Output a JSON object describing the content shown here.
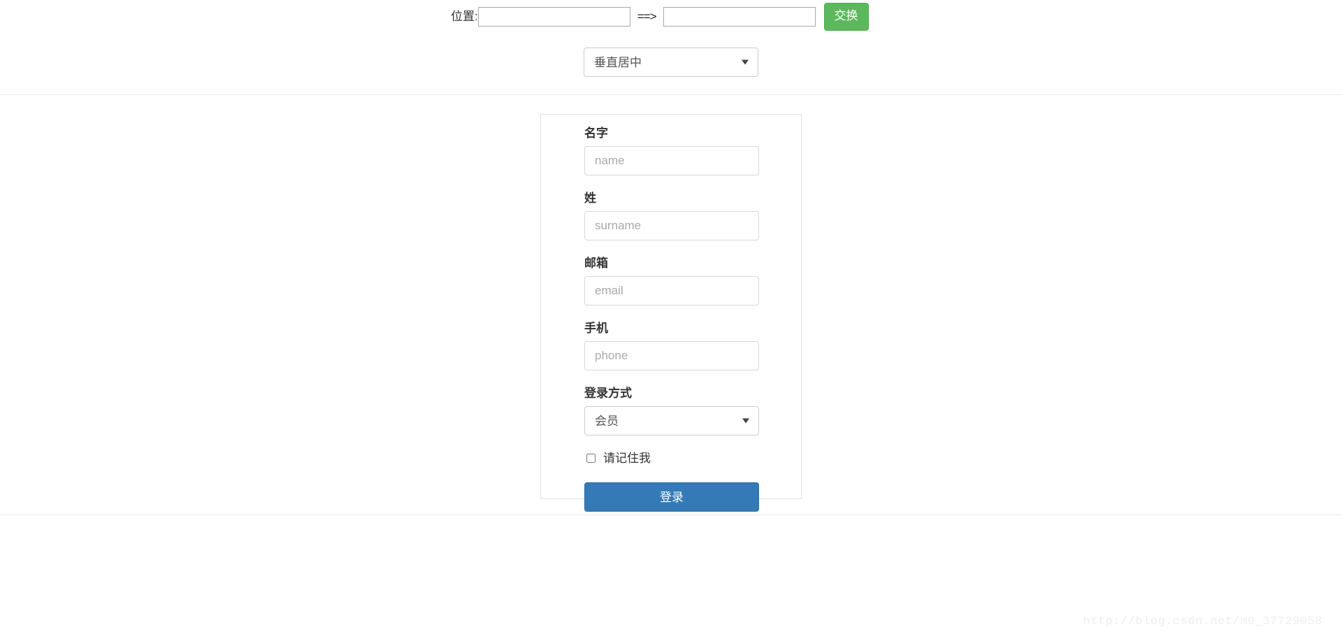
{
  "topbar": {
    "position_label": "位置:",
    "input_from_value": "",
    "input_from_placeholder": "",
    "arrow_text": "==>",
    "input_to_value": "",
    "input_to_placeholder": "",
    "swap_button_label": "交换",
    "swap_button_color": "#5cb85c"
  },
  "align_control": {
    "selected_option": "垂直居中",
    "options": [
      "垂直居中"
    ],
    "arrow_icon": "chevron-down-icon"
  },
  "form": {
    "fields": [
      {
        "label": "名字",
        "placeholder": "name",
        "value": "",
        "name": "first-name"
      },
      {
        "label": "姓",
        "placeholder": "surname",
        "value": "",
        "name": "surname"
      },
      {
        "label": "邮箱",
        "placeholder": "email",
        "value": "",
        "name": "email"
      },
      {
        "label": "手机",
        "placeholder": "phone",
        "value": "",
        "name": "phone"
      }
    ],
    "login_method": {
      "label": "登录方式",
      "selected_option": "会员",
      "options": [
        "会员"
      ]
    },
    "remember_me": {
      "label": "请记住我",
      "checked": false
    },
    "submit_button": {
      "label": "登录",
      "color": "#337ab7"
    }
  },
  "watermark": {
    "text": "http://blog.csdn.net/m0_37729058"
  }
}
